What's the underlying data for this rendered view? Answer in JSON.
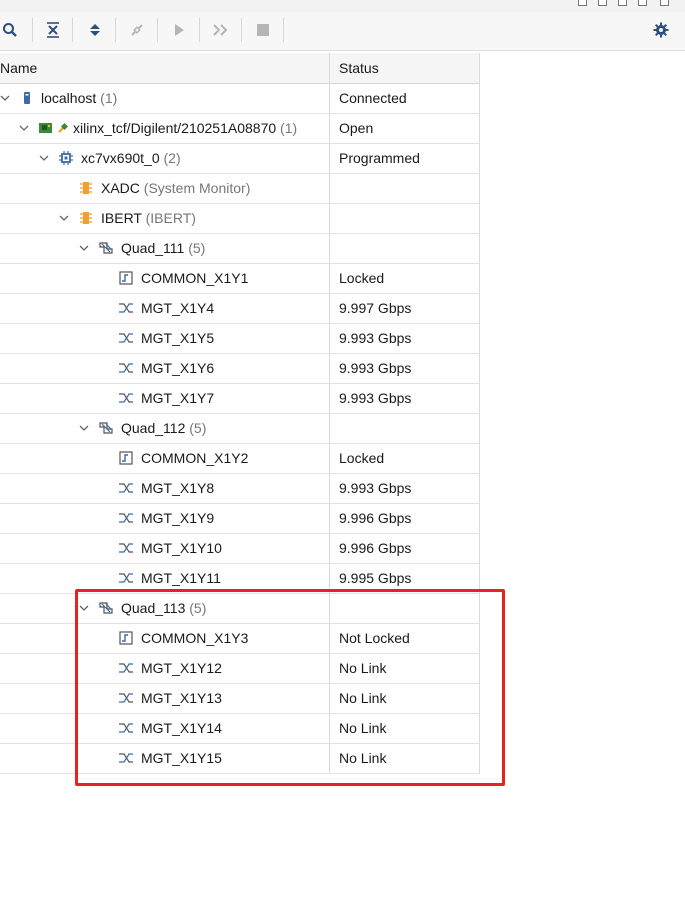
{
  "columns": {
    "name": "Name",
    "status": "Status"
  },
  "colors": {
    "highlight": "#e8231f",
    "icon_blue": "#3d6aa8",
    "icon_orange": "#f0a030",
    "board_green": "#3a8a3a"
  },
  "rows": [
    {
      "label": "localhost",
      "count": "(1)",
      "status": "Connected",
      "icon": "server-icon"
    },
    {
      "label": "xilinx_tcf/Digilent/210251A08870",
      "count": "(1)",
      "status": "Open",
      "icon": "board-icon"
    },
    {
      "label": "xc7vx690t_0",
      "count": "(2)",
      "status": "Programmed",
      "icon": "chip-icon"
    },
    {
      "label": "XADC",
      "count": "(System Monitor)",
      "status": "",
      "icon": "ip-core-icon"
    },
    {
      "label": "IBERT",
      "count": "(IBERT)",
      "status": "",
      "icon": "ip-core-icon"
    },
    {
      "label": "Quad_111",
      "count": "(5)",
      "status": "",
      "icon": "quad-icon"
    },
    {
      "label": "COMMON_X1Y1",
      "count": "",
      "status": "Locked",
      "icon": "pll-icon"
    },
    {
      "label": "MGT_X1Y4",
      "count": "",
      "status": "9.997 Gbps",
      "icon": "mgt-icon"
    },
    {
      "label": "MGT_X1Y5",
      "count": "",
      "status": "9.993 Gbps",
      "icon": "mgt-icon"
    },
    {
      "label": "MGT_X1Y6",
      "count": "",
      "status": "9.993 Gbps",
      "icon": "mgt-icon"
    },
    {
      "label": "MGT_X1Y7",
      "count": "",
      "status": "9.993 Gbps",
      "icon": "mgt-icon"
    },
    {
      "label": "Quad_112",
      "count": "(5)",
      "status": "",
      "icon": "quad-icon"
    },
    {
      "label": "COMMON_X1Y2",
      "count": "",
      "status": "Locked",
      "icon": "pll-icon"
    },
    {
      "label": "MGT_X1Y8",
      "count": "",
      "status": "9.993 Gbps",
      "icon": "mgt-icon"
    },
    {
      "label": "MGT_X1Y9",
      "count": "",
      "status": "9.996 Gbps",
      "icon": "mgt-icon"
    },
    {
      "label": "MGT_X1Y10",
      "count": "",
      "status": "9.996 Gbps",
      "icon": "mgt-icon"
    },
    {
      "label": "MGT_X1Y11",
      "count": "",
      "status": "9.995 Gbps",
      "icon": "mgt-icon"
    },
    {
      "label": "Quad_113",
      "count": "(5)",
      "status": "",
      "icon": "quad-icon"
    },
    {
      "label": "COMMON_X1Y3",
      "count": "",
      "status": "Not Locked",
      "icon": "pll-icon"
    },
    {
      "label": "MGT_X1Y12",
      "count": "",
      "status": "No Link",
      "icon": "mgt-icon"
    },
    {
      "label": "MGT_X1Y13",
      "count": "",
      "status": "No Link",
      "icon": "mgt-icon"
    },
    {
      "label": "MGT_X1Y14",
      "count": "",
      "status": "No Link",
      "icon": "mgt-icon"
    },
    {
      "label": "MGT_X1Y15",
      "count": "",
      "status": "No Link",
      "icon": "mgt-icon"
    }
  ]
}
